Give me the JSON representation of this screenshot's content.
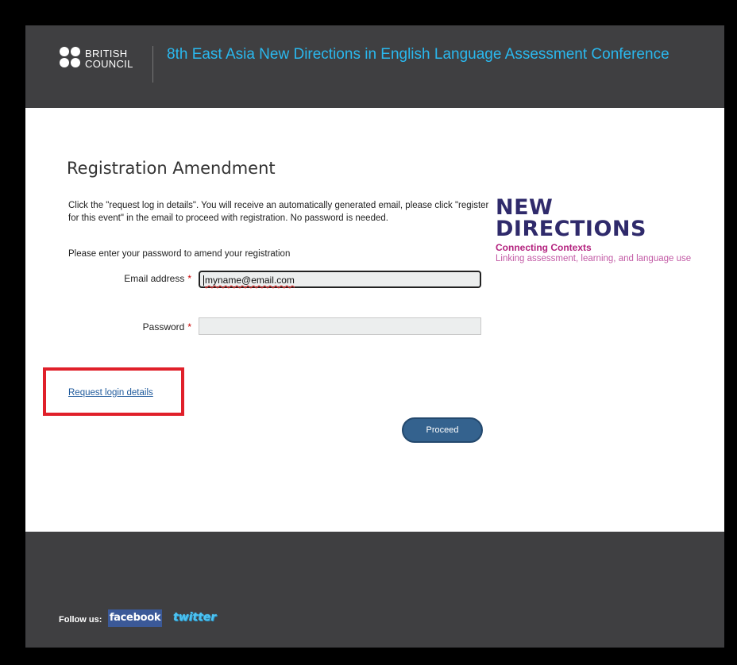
{
  "header": {
    "logo_lines": [
      "BRITISH",
      "COUNCIL"
    ],
    "conference_title": "8th East Asia New Directions in English Language Assessment Conference"
  },
  "main": {
    "page_title": "Registration Amendment",
    "intro": "Click the \"request log in details\". You will receive an automatically generated email, please click \"register for this event\" in the email to proceed with registration. No password is needed.",
    "prompt": "Please enter your password to amend your registration",
    "email_label": "Email address",
    "email_value": "myname@email.com",
    "password_label": "Password",
    "password_value": "",
    "required_mark": "*",
    "request_link": "Request login details",
    "proceed_label": "Proceed"
  },
  "side_logo": {
    "line1": "NEW",
    "line2": "DIRECTIONS",
    "tagline": "Connecting Contexts",
    "subtitle": "Linking assessment, learning, and language use"
  },
  "footer": {
    "follow_label": "Follow us:",
    "facebook_label": "facebook",
    "twitter_label": "twitter"
  },
  "colors": {
    "header_bg": "#3f3f41",
    "title_blue": "#2ab8ee",
    "highlight_red": "#e0202a",
    "button_blue": "#34628e",
    "nd_navy": "#2f2a6b",
    "nd_magenta": "#b4237f"
  }
}
